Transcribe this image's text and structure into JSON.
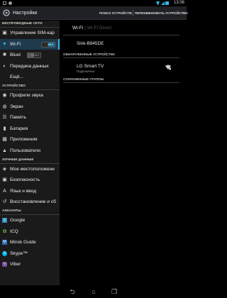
{
  "status_bar": {
    "time": "13:06"
  },
  "action_bar": {
    "title": "Настройки",
    "actions": [
      "ПОИСК УСТРОЙСТВ",
      "ПЕРЕИМЕНОВАТЬ УСТРОЙСТВО"
    ]
  },
  "sidebar": {
    "sections": {
      "wireless": "БЕСПРОВОДНЫЕ СЕТИ",
      "device": "УСТРОЙСТВО",
      "personal": "ЛИЧНЫЕ ДАННЫЕ",
      "accounts": "АККАУНТЫ"
    },
    "items": {
      "sim": "Управление SIM-кар",
      "wifi": "Wi-Fi",
      "bluetooth": "Bluet",
      "data": "Передача данных",
      "more": "Ещё...",
      "sound": "Профили звука",
      "screen": "Экран",
      "memory": "Память",
      "battery": "Батарея",
      "apps": "Приложения",
      "users": "Пользователи",
      "location": "Мое местоположени",
      "security": "Безопасность",
      "language": "Язык и ввод",
      "backup": "Восстановление и сб",
      "google": "Google",
      "icq": "ICQ",
      "minsk": "Minsk Guide",
      "skype": "Skype™",
      "viber": "Viber"
    },
    "toggles": {
      "wifi": "ВКЛ",
      "bluetooth": "ВЫКЛ"
    }
  },
  "wifi_direct": {
    "tabs": [
      "Wi-Fi",
      "Wi-Fi Direct"
    ],
    "my_device": "Sink-B845DE",
    "found_header": "ОБНАРУЖЕННЫЕ УСТРОЙСТВА",
    "peer": {
      "name": "LG Smart TV",
      "status": "Подключено"
    },
    "saved_header": "СОХРАНЕННЫЕ ГРУППЫ"
  },
  "colors": {
    "accent": "#33b5e5",
    "selected_bg": "#1f3a4d"
  }
}
